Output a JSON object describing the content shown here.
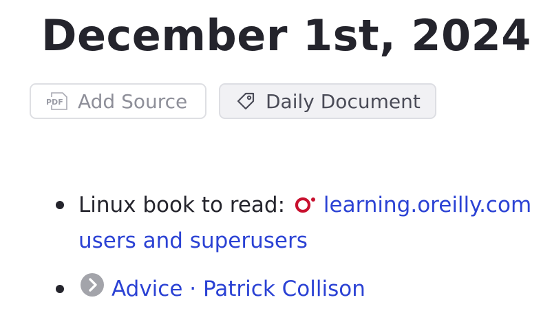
{
  "page": {
    "title": "December 1st, 2024"
  },
  "actions": {
    "add_source_label": "Add Source",
    "add_source_icon": "pdf-icon",
    "tag_label": "Daily Document",
    "tag_icon": "tag-icon"
  },
  "bullets": [
    {
      "prefix": "Linux book to read: ",
      "favicon": "oreilly-logo-icon",
      "link_line1": "learning.oreilly.com",
      "link_line2": "users and superusers"
    },
    {
      "favicon": "chevron-right-circle-icon",
      "link_text": "Advice · Patrick Collison"
    }
  ],
  "colors": {
    "link": "#2b42d4",
    "text": "#24242c",
    "oreilly_red": "#c8102e",
    "muted": "#8e8f99"
  }
}
